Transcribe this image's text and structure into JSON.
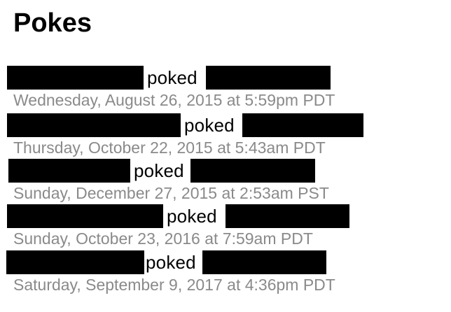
{
  "page": {
    "title": "Pokes"
  },
  "redaction_color": "#000000",
  "timestamp_color": "#8a8a8a",
  "pokes": [
    {
      "verb": "poked",
      "timestamp": "Wednesday, August 26, 2015 at 5:59pm PDT"
    },
    {
      "verb": "poked",
      "timestamp": "Thursday, October 22, 2015 at 5:43am PDT"
    },
    {
      "verb": "poked",
      "timestamp": "Sunday, December 27, 2015 at 2:53am PST"
    },
    {
      "verb": "poked",
      "timestamp": "Sunday, October 23, 2016 at 7:59am PDT"
    },
    {
      "verb": "poked",
      "timestamp": "Saturday, September 9, 2017 at 4:36pm PDT"
    }
  ]
}
